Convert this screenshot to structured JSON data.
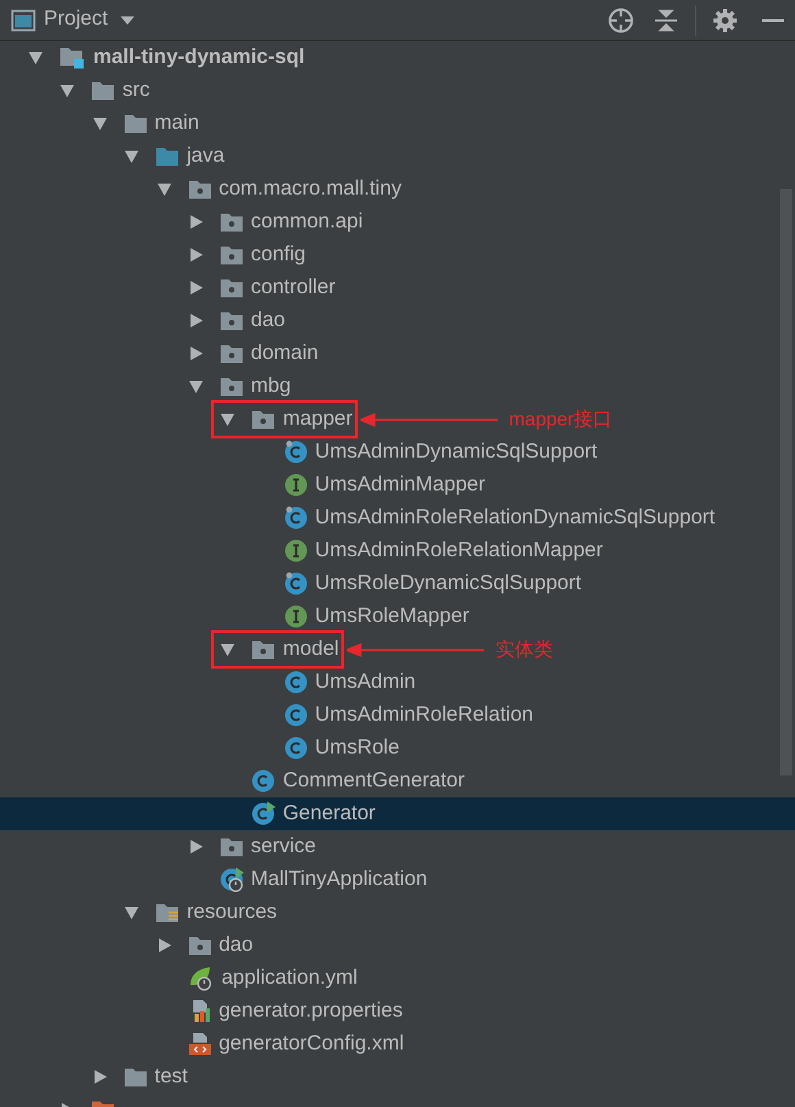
{
  "header": {
    "title": "Project"
  },
  "tree": [
    {
      "label": "mall-tiny-dynamic-sql",
      "kind": "module",
      "bold": true,
      "expanded": true,
      "selected": false,
      "children": [
        {
          "label": "src",
          "kind": "folder",
          "expanded": true,
          "selected": false,
          "children": [
            {
              "label": "main",
              "kind": "folder",
              "expanded": true,
              "selected": false,
              "children": [
                {
                  "label": "java",
                  "kind": "source-folder",
                  "expanded": true,
                  "selected": false,
                  "children": [
                    {
                      "label": "com.macro.mall.tiny",
                      "kind": "package",
                      "expanded": true,
                      "selected": false,
                      "children": [
                        {
                          "label": "common.api",
                          "kind": "package",
                          "expanded": false,
                          "selected": false
                        },
                        {
                          "label": "config",
                          "kind": "package",
                          "expanded": false,
                          "selected": false
                        },
                        {
                          "label": "controller",
                          "kind": "package",
                          "expanded": false,
                          "selected": false
                        },
                        {
                          "label": "dao",
                          "kind": "package",
                          "expanded": false,
                          "selected": false
                        },
                        {
                          "label": "domain",
                          "kind": "package",
                          "expanded": false,
                          "selected": false
                        },
                        {
                          "label": "mbg",
                          "kind": "package",
                          "expanded": true,
                          "selected": false,
                          "children": [
                            {
                              "label": "mapper",
                              "kind": "package",
                              "expanded": true,
                              "selected": false,
                              "annotation": "mapper接口",
                              "children": [
                                {
                                  "label": "UmsAdminDynamicSqlSupport",
                                  "kind": "class-marked",
                                  "selected": false
                                },
                                {
                                  "label": "UmsAdminMapper",
                                  "kind": "interface",
                                  "selected": false
                                },
                                {
                                  "label": "UmsAdminRoleRelationDynamicSqlSupport",
                                  "kind": "class-marked",
                                  "selected": false
                                },
                                {
                                  "label": "UmsAdminRoleRelationMapper",
                                  "kind": "interface",
                                  "selected": false
                                },
                                {
                                  "label": "UmsRoleDynamicSqlSupport",
                                  "kind": "class-marked",
                                  "selected": false
                                },
                                {
                                  "label": "UmsRoleMapper",
                                  "kind": "interface",
                                  "selected": false
                                }
                              ]
                            },
                            {
                              "label": "model",
                              "kind": "package",
                              "expanded": true,
                              "selected": false,
                              "annotation": "实体类",
                              "children": [
                                {
                                  "label": "UmsAdmin",
                                  "kind": "class",
                                  "selected": false
                                },
                                {
                                  "label": "UmsAdminRoleRelation",
                                  "kind": "class",
                                  "selected": false
                                },
                                {
                                  "label": "UmsRole",
                                  "kind": "class",
                                  "selected": false
                                }
                              ]
                            },
                            {
                              "label": "CommentGenerator",
                              "kind": "class",
                              "selected": false
                            },
                            {
                              "label": "Generator",
                              "kind": "main-class",
                              "selected": true
                            }
                          ]
                        },
                        {
                          "label": "service",
                          "kind": "package",
                          "expanded": false,
                          "selected": false
                        },
                        {
                          "label": "MallTinyApplication",
                          "kind": "spring-app",
                          "selected": false
                        }
                      ]
                    }
                  ]
                },
                {
                  "label": "resources",
                  "kind": "resources-folder",
                  "expanded": true,
                  "selected": false,
                  "children": [
                    {
                      "label": "dao",
                      "kind": "package",
                      "expanded": false,
                      "selected": false
                    },
                    {
                      "label": "application.yml",
                      "kind": "yml",
                      "selected": false
                    },
                    {
                      "label": "generator.properties",
                      "kind": "properties",
                      "selected": false
                    },
                    {
                      "label": "generatorConfig.xml",
                      "kind": "xml",
                      "selected": false
                    }
                  ]
                }
              ]
            },
            {
              "label": "test",
              "kind": "folder",
              "expanded": false,
              "selected": false
            }
          ]
        },
        {
          "kind": "excluded-folder",
          "expanded": false,
          "selected": false
        }
      ]
    }
  ]
}
